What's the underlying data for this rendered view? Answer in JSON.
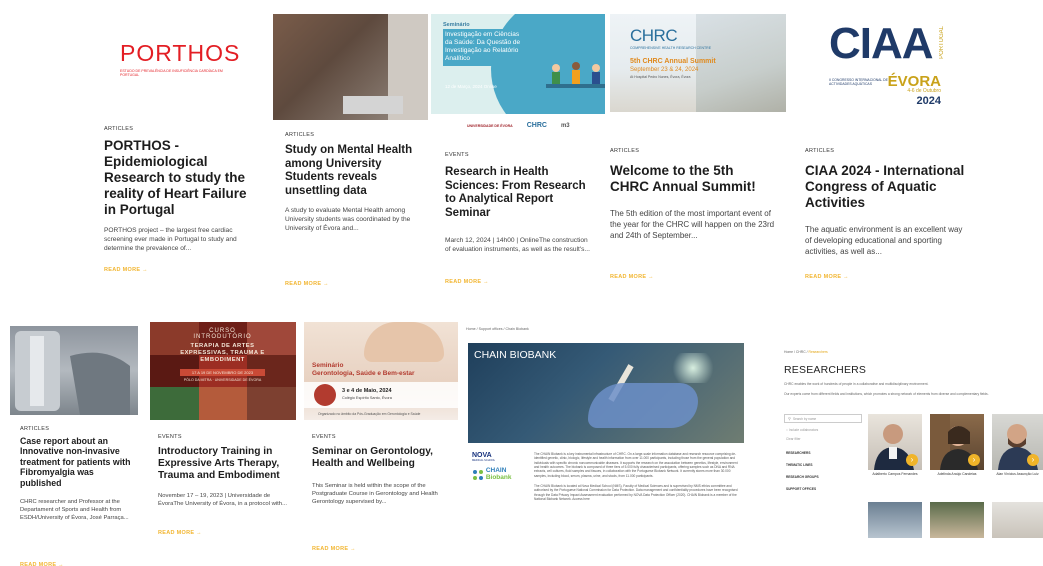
{
  "read_more": "READ MORE",
  "cards": [
    {
      "category": "ARTICLES",
      "title": "PORTHOS - Epidemiological Research to study the reality of Heart Failure in Portugal",
      "excerpt": "PORTHOS project – the largest free cardiac screening ever made in Portugal to study and determine the prevalence of...",
      "logo_word": "PORTHOS",
      "logo_sub": "ESTUDO DE PREVALÊNCIA DE INSUFICIÊNCIA CARDÍACA EM PORTUGAL"
    },
    {
      "category": "ARTICLES",
      "title": "Study on Mental Health among University Students reveals unsettling data",
      "excerpt": "A study to evaluate Mental Health among University students was coordinated by the University of Évora and..."
    },
    {
      "category": "EVENTS",
      "title": "Research in Health Sciences: From Research to Analytical Report Seminar",
      "excerpt": "March 12, 2024 | 14h00 | OnlineThe construction of evaluation instruments, as well as the result's...",
      "banner_label": "Seminário",
      "banner_text": "Investigação em Ciências da Saúde: Da Questão de Investigação ao Relatório Analítico",
      "banner_date": "12 de Março, 2024 Online",
      "logos": [
        "UNIVERSIDADE DE ÉVORA",
        "CHRC",
        "m3"
      ]
    },
    {
      "category": "ARTICLES",
      "title": "Welcome to the 5th CHRC Annual Summit!",
      "excerpt": "The 5th edition of the most important event of the year for the CHRC will happen on the 23rd and 24th of September...",
      "img_chrc": "CHRC",
      "img_sub": "COMPREHENSIVE HEALTH RESEARCH CENTRE",
      "img_t1": "5th CHRC Annual Summit",
      "img_t2": "September 23 & 24, 2024",
      "img_t3": "At Hospital Pedro Nunes, Évora, Évora"
    },
    {
      "category": "ARTICLES",
      "title": "CIAA 2024 - International Congress of Aquatic Activities",
      "excerpt": "The aquatic environment is an excellent way of developing educational and sporting activities, as well as...",
      "logo_big": "CIAA",
      "logo_evora": "ÉVORA",
      "logo_date": "4-6 de Outubro",
      "logo_year": "2024",
      "logo_portugal": "PORTUGAL",
      "logo_small": "II CONGRESSO INTERNACIONAL DE ACTIVIDADES AQUÁTICAS"
    },
    {
      "category": "ARTICLES",
      "title": "Case report about an Innovative non-invasive treatment for patients with Fibromyalgia was published",
      "excerpt": "CHRC researcher and Professor at the Departament of Sports and Health from ESDH/University of Évora, José Parraça..."
    },
    {
      "category": "EVENTS",
      "title": "Introductory Training in Expressive Arts Therapy, Trauma and Embodiment",
      "excerpt": "November 17 – 19, 2023 | Universidade de ÉvoraThe University of Évora, in a protocol with...",
      "img_o1": "CURSO INTRODUTÓRIO",
      "img_o2": "TERAPIA DE ARTES EXPRESSIVAS, TRAUMA E EMBODIMENT",
      "img_o3": "17 A 19 DE NOVEMBRO DE 2023",
      "img_o4": "PÓLO DA MITRA · UNIVERSIDADE DE ÉVORA"
    },
    {
      "category": "EVENTS",
      "title": "Seminar on Gerontology, Health and Wellbeing",
      "excerpt": "This Seminar is held within the scope of the Postgraduate Course in Gerontology and Health Gerontology supervised by...",
      "img_s1": "Seminário",
      "img_s2": "Gerontologia, Saúde e Bem-estar",
      "img_d1": "3 e 4 de Maio, 2024",
      "img_d2": "Colégio Espírito Santo, Évora",
      "img_d3": "Organizado no âmbito da Pós-Graduação em Gerontologia e Saúde"
    }
  ],
  "biobank": {
    "breadcrumb": "Home / Support offices / Chain Biobank",
    "hero_title": "CHAIN BIOBANK",
    "logo_nova": "NOVA",
    "logo_nova_sub": "MEDICAL SCHOOL",
    "logo_chain": "CHAIN",
    "logo_biobank": "Biobank",
    "para1": "The CHAIN Biobank is a key instrumental infrastructure of CHRC. On a large-scale information database and research resource comprising de-identified genetic, clinic, biologic, lifestyle and health information from over 11.000 participants, including those from the general population and individuals with specific chronic noncommunicable diseases. It supports the research on the association between genetics, lifestyle, environment and health outcomes. The biobank is composed of three tiers of 5.000 fully characterised participants, offering samples such as DNA and RNA extracts, cell cultures, fluid samples and tissues, in collaboration with the Portuguese Biobank Network. It currently stores more than 30.000 samples, including blood, serum, plasma, urine, and stools, from 11.000 participants.",
    "para2": "The CHAIN Biobank is located at Nova Medical School (NMS), Faculty of Medical Sciences and is supervised by NMS ethics committee and authorised by the Portuguese National Commission for Data Protection. Data management and confidentiality procedures have been recognised through the Data Privacy Impact Assessment evaluation performed by NOVA Data Protection Officer (2020). CHAIN Biobank is a member of the National Biobank Network. Access here"
  },
  "researchers": {
    "breadcrumb_home": "Home",
    "breadcrumb_mid": "CHRC",
    "breadcrumb_current": "Researchers",
    "title": "RESEARCHERS",
    "p1": "CHRC enables the work of hundreds of people in a collaborative and multidisciplinary environment.",
    "p2": "Our experts come from different fields and institutions, which promotes a strong network of elements from diverse and complementary fields.",
    "search_placeholder": "Search by name",
    "opt1": "Include collaborators",
    "opt2": "Clear filter",
    "menu": [
      "RESEARCHERS",
      "THEMATIC LINES",
      "RESEARCH GROUPS",
      "SUPPORT OFFICES"
    ],
    "people": [
      {
        "name": "Adalberto Campos Fernandes"
      },
      {
        "name": "Adelinda Araújo Candeias"
      },
      {
        "name": "Alan Vinícius Assunção Luiz"
      }
    ]
  },
  "colors": {
    "accent": "#f2b632",
    "title": "#1d1d1d",
    "porthos_red": "#e31e24",
    "ciaa_blue": "#1f3a68"
  }
}
